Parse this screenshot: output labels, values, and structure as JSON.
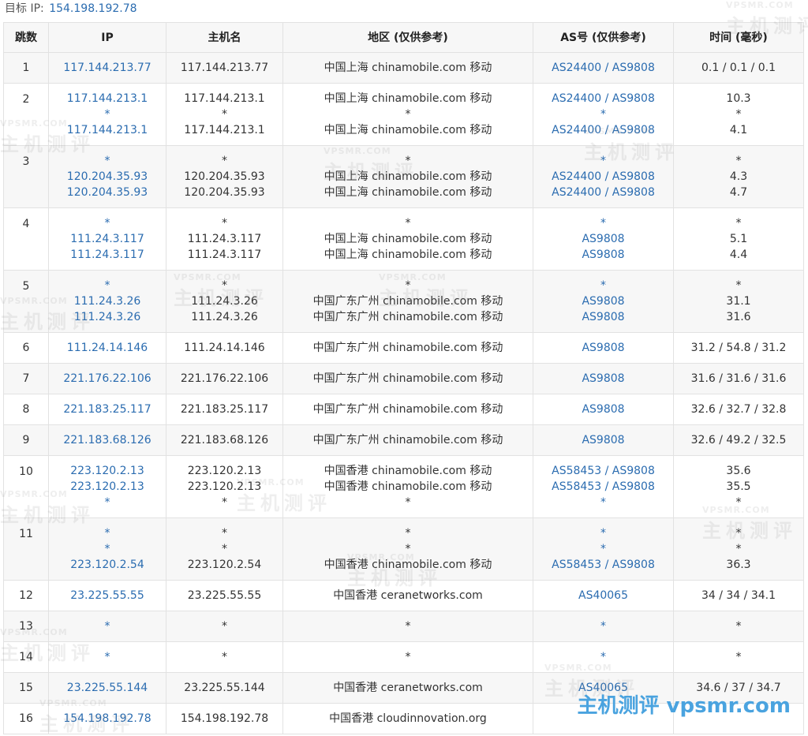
{
  "target": {
    "label": "目标 IP:",
    "ip": "154.198.192.78"
  },
  "headers": [
    "跳数",
    "IP",
    "主机名",
    "地区 (仅供参考)",
    "AS号 (仅供参考)",
    "时间 (毫秒)"
  ],
  "hops": [
    {
      "hop": "1",
      "lines": [
        {
          "ip": "117.144.213.77",
          "host": "117.144.213.77",
          "region": "中国上海 chinamobile.com 移动",
          "as": "AS24400 / AS9808",
          "time": "0.1 / 0.1 / 0.1"
        }
      ]
    },
    {
      "hop": "2",
      "lines": [
        {
          "ip": "117.144.213.1",
          "host": "117.144.213.1",
          "region": "中国上海 chinamobile.com 移动",
          "as": "AS24400 / AS9808",
          "time": "10.3"
        },
        {
          "ip": "*",
          "host": "*",
          "region": "*",
          "as": "*",
          "time": "*"
        },
        {
          "ip": "117.144.213.1",
          "host": "117.144.213.1",
          "region": "中国上海 chinamobile.com 移动",
          "as": "AS24400 / AS9808",
          "time": "4.1"
        }
      ]
    },
    {
      "hop": "3",
      "lines": [
        {
          "ip": "*",
          "host": "*",
          "region": "*",
          "as": "*",
          "time": "*"
        },
        {
          "ip": "120.204.35.93",
          "host": "120.204.35.93",
          "region": "中国上海 chinamobile.com 移动",
          "as": "AS24400 / AS9808",
          "time": "4.3"
        },
        {
          "ip": "120.204.35.93",
          "host": "120.204.35.93",
          "region": "中国上海 chinamobile.com 移动",
          "as": "AS24400 / AS9808",
          "time": "4.7"
        }
      ]
    },
    {
      "hop": "4",
      "lines": [
        {
          "ip": "*",
          "host": "*",
          "region": "*",
          "as": "*",
          "time": "*"
        },
        {
          "ip": "111.24.3.117",
          "host": "111.24.3.117",
          "region": "中国上海 chinamobile.com 移动",
          "as": "AS9808",
          "time": "5.1"
        },
        {
          "ip": "111.24.3.117",
          "host": "111.24.3.117",
          "region": "中国上海 chinamobile.com 移动",
          "as": "AS9808",
          "time": "4.4"
        }
      ]
    },
    {
      "hop": "5",
      "lines": [
        {
          "ip": "*",
          "host": "*",
          "region": "*",
          "as": "*",
          "time": "*"
        },
        {
          "ip": "111.24.3.26",
          "host": "111.24.3.26",
          "region": "中国广东广州 chinamobile.com 移动",
          "as": "AS9808",
          "time": "31.1"
        },
        {
          "ip": "111.24.3.26",
          "host": "111.24.3.26",
          "region": "中国广东广州 chinamobile.com 移动",
          "as": "AS9808",
          "time": "31.6"
        }
      ]
    },
    {
      "hop": "6",
      "lines": [
        {
          "ip": "111.24.14.146",
          "host": "111.24.14.146",
          "region": "中国广东广州 chinamobile.com 移动",
          "as": "AS9808",
          "time": "31.2 / 54.8 / 31.2"
        }
      ]
    },
    {
      "hop": "7",
      "lines": [
        {
          "ip": "221.176.22.106",
          "host": "221.176.22.106",
          "region": "中国广东广州 chinamobile.com 移动",
          "as": "AS9808",
          "time": "31.6 / 31.6 / 31.6"
        }
      ]
    },
    {
      "hop": "8",
      "lines": [
        {
          "ip": "221.183.25.117",
          "host": "221.183.25.117",
          "region": "中国广东广州 chinamobile.com 移动",
          "as": "AS9808",
          "time": "32.6 / 32.7 / 32.8"
        }
      ]
    },
    {
      "hop": "9",
      "lines": [
        {
          "ip": "221.183.68.126",
          "host": "221.183.68.126",
          "region": "中国广东广州 chinamobile.com 移动",
          "as": "AS9808",
          "time": "32.6 / 49.2 / 32.5"
        }
      ]
    },
    {
      "hop": "10",
      "lines": [
        {
          "ip": "223.120.2.13",
          "host": "223.120.2.13",
          "region": "中国香港 chinamobile.com 移动",
          "as": "AS58453 / AS9808",
          "time": "35.6"
        },
        {
          "ip": "223.120.2.13",
          "host": "223.120.2.13",
          "region": "中国香港 chinamobile.com 移动",
          "as": "AS58453 / AS9808",
          "time": "35.5"
        },
        {
          "ip": "*",
          "host": "*",
          "region": "*",
          "as": "*",
          "time": "*"
        }
      ]
    },
    {
      "hop": "11",
      "lines": [
        {
          "ip": "*",
          "host": "*",
          "region": "*",
          "as": "*",
          "time": "*"
        },
        {
          "ip": "*",
          "host": "*",
          "region": "*",
          "as": "*",
          "time": "*"
        },
        {
          "ip": "223.120.2.54",
          "host": "223.120.2.54",
          "region": "中国香港 chinamobile.com 移动",
          "as": "AS58453 / AS9808",
          "time": "36.3"
        }
      ]
    },
    {
      "hop": "12",
      "lines": [
        {
          "ip": "23.225.55.55",
          "host": "23.225.55.55",
          "region": "中国香港 ceranetworks.com",
          "as": "AS40065",
          "time": "34 / 34 / 34.1"
        }
      ]
    },
    {
      "hop": "13",
      "lines": [
        {
          "ip": "*",
          "host": "*",
          "region": "*",
          "as": "*",
          "time": "*"
        }
      ]
    },
    {
      "hop": "14",
      "lines": [
        {
          "ip": "*",
          "host": "*",
          "region": "*",
          "as": "*",
          "time": "*"
        }
      ]
    },
    {
      "hop": "15",
      "lines": [
        {
          "ip": "23.225.55.144",
          "host": "23.225.55.144",
          "region": "中国香港 ceranetworks.com",
          "as": "AS40065",
          "time": "34.6 / 37 / 34.7"
        }
      ]
    },
    {
      "hop": "16",
      "lines": [
        {
          "ip": "154.198.192.78",
          "host": "154.198.192.78",
          "region": "中国香港 cloudinnovation.org",
          "as": "",
          "time": ""
        }
      ]
    }
  ],
  "watermark": {
    "small": "VPSMR.COM",
    "large": "主机测评"
  },
  "brand": "主机测评 vpsmr.com"
}
